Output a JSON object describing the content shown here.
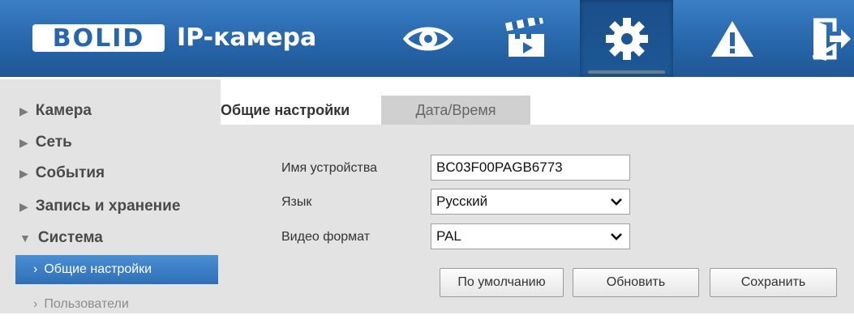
{
  "header": {
    "logo_text": "BOLID",
    "app_title": "IP-камера",
    "nav_icons": [
      "eye-icon",
      "clapperboard-icon",
      "gear-icon",
      "warning-icon",
      "exit-icon"
    ],
    "active_nav": "gear-icon"
  },
  "sidebar": {
    "items": [
      {
        "label": "Камера",
        "expanded": false
      },
      {
        "label": "Сеть",
        "expanded": false
      },
      {
        "label": "События",
        "expanded": false
      },
      {
        "label": "Запись и хранение",
        "expanded": false
      },
      {
        "label": "Система",
        "expanded": true
      }
    ],
    "subitems": [
      {
        "label": "Общие настройки",
        "active": true
      },
      {
        "label": "Пользователи",
        "active": false
      }
    ]
  },
  "tabs": [
    {
      "label": "Общие настройки",
      "active": true
    },
    {
      "label": "Дата/Время",
      "active": false
    }
  ],
  "form": {
    "device_name_label": "Имя устройства",
    "device_name_value": "BC03F00PAGB6773",
    "language_label": "Язык",
    "language_value": "Русский",
    "video_format_label": "Видео формат",
    "video_format_value": "PAL"
  },
  "buttons": {
    "default_label": "По умолчанию",
    "refresh_label": "Обновить",
    "save_label": "Сохранить"
  },
  "colors": {
    "header_blue": "#2766ab",
    "menu_active_blue": "#3f81c8",
    "panel_gray": "#e3e3e3"
  }
}
